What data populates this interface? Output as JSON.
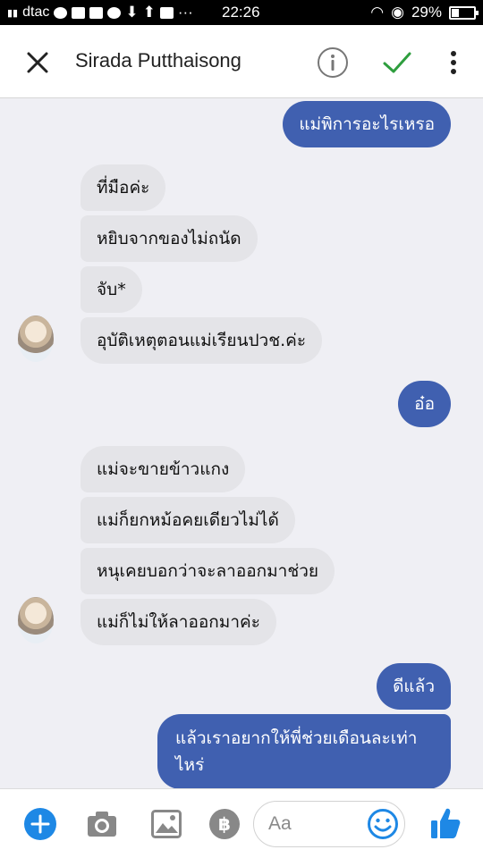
{
  "status_bar": {
    "carrier": "dtac",
    "time": "22:26",
    "battery": "29%",
    "battery_level": 0.29,
    "dots": "···"
  },
  "header": {
    "contact_name": "Sirada Putthaisong"
  },
  "messages": [
    {
      "direction": "outgoing",
      "text": "แม่พิการอะไรเหรอ"
    },
    {
      "direction": "incoming",
      "text": "ที่มือค่ะ"
    },
    {
      "direction": "incoming",
      "text": "หยิบจากของไม่ถนัด"
    },
    {
      "direction": "incoming",
      "text": "จับ*"
    },
    {
      "direction": "incoming",
      "text": "อุบัติเหตุตอนแม่เรียนปวช.ค่ะ"
    },
    {
      "direction": "outgoing",
      "text": "อ๋อ"
    },
    {
      "direction": "incoming",
      "text": "แม่จะขายข้าวแกง"
    },
    {
      "direction": "incoming",
      "text": "แม่ก็ยกหม้อคยเดียวไม่ได้"
    },
    {
      "direction": "incoming",
      "text": "หนุเคยบอกว่าจะลาออกมาช่วย"
    },
    {
      "direction": "incoming",
      "text": "แม่ก็ไม่ให้ลาออกมาค่ะ"
    },
    {
      "direction": "outgoing",
      "text": "ดีแล้ว"
    },
    {
      "direction": "outgoing",
      "text": "แล้วเราอยากให้พี่ช่วยเดือนละเท่าไหร่"
    }
  ],
  "composer": {
    "placeholder": "Aa"
  },
  "colors": {
    "outgoing_bubble": "#4060b0",
    "incoming_bubble": "#e4e4e8",
    "accent_blue": "#1e88e5",
    "check_green": "#2e9e3e"
  },
  "icons": [
    "close-icon",
    "info-icon",
    "check-icon",
    "more-vertical-icon",
    "plus-icon",
    "camera-icon",
    "gallery-icon",
    "baht-payment-icon",
    "emoji-icon",
    "thumbs-up-icon"
  ]
}
